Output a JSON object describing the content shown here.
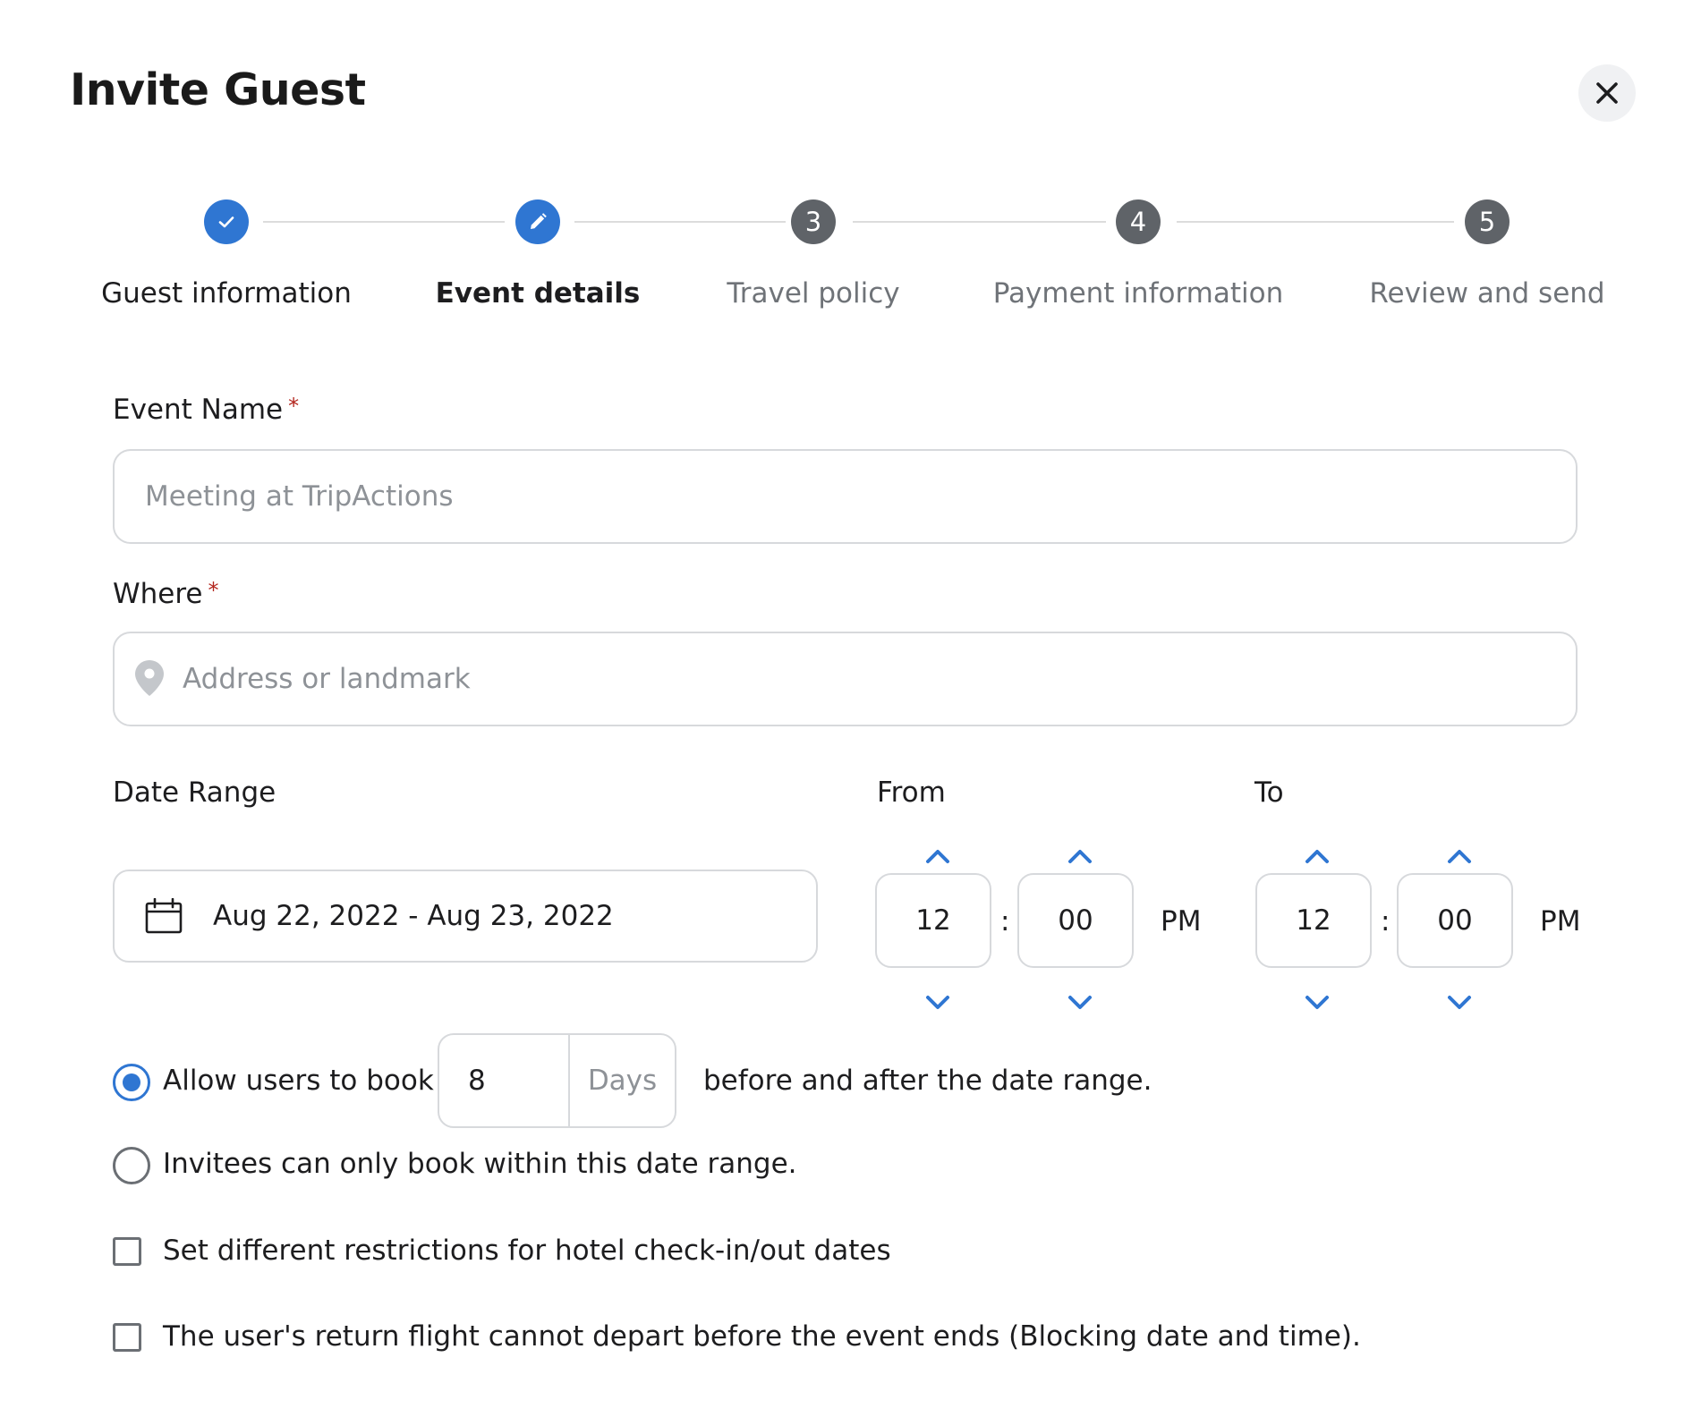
{
  "dialog": {
    "title": "Invite Guest",
    "close_icon": "close-icon"
  },
  "stepper": {
    "steps": [
      {
        "label": "Guest information",
        "number": "",
        "state": "done",
        "icon": "check-icon"
      },
      {
        "label": "Event details",
        "number": "",
        "state": "current",
        "icon": "pencil-icon"
      },
      {
        "label": "Travel policy",
        "number": "3",
        "state": "future"
      },
      {
        "label": "Payment information",
        "number": "4",
        "state": "future"
      },
      {
        "label": "Review and send",
        "number": "5",
        "state": "future"
      }
    ]
  },
  "form": {
    "event_name": {
      "label": "Event Name",
      "required_mark": "*",
      "value": "",
      "placeholder": "Meeting at TripActions"
    },
    "where": {
      "label": "Where",
      "required_mark": "*",
      "value": "",
      "placeholder": "Address or landmark",
      "icon": "map-pin-icon"
    },
    "date_range": {
      "label": "Date Range",
      "value": "Aug 22, 2022 - Aug 23, 2022",
      "icon": "calendar-icon"
    },
    "from": {
      "label": "From",
      "hour": "12",
      "separator": ":",
      "minute": "00",
      "period": "PM"
    },
    "to": {
      "label": "To",
      "hour": "12",
      "separator": ":",
      "minute": "00",
      "period": "PM"
    },
    "booking": {
      "allow_label": "Allow users to book",
      "allow_checked": true,
      "days_value": "8",
      "days_unit": "Days",
      "allow_suffix": "before and after the date range.",
      "within_label": "Invitees can only book within this date range.",
      "within_checked": false
    },
    "checkboxes": {
      "hotel_label": "Set different restrictions for hotel check-in/out dates",
      "hotel_checked": false,
      "flight_label": "The user's return flight cannot depart before the event ends (Blocking date and time).",
      "flight_checked": false
    }
  },
  "colors": {
    "accent": "#2f76d2",
    "step_pending": "#5f6368",
    "border": "#d7d9dc",
    "required": "#b3261e"
  }
}
